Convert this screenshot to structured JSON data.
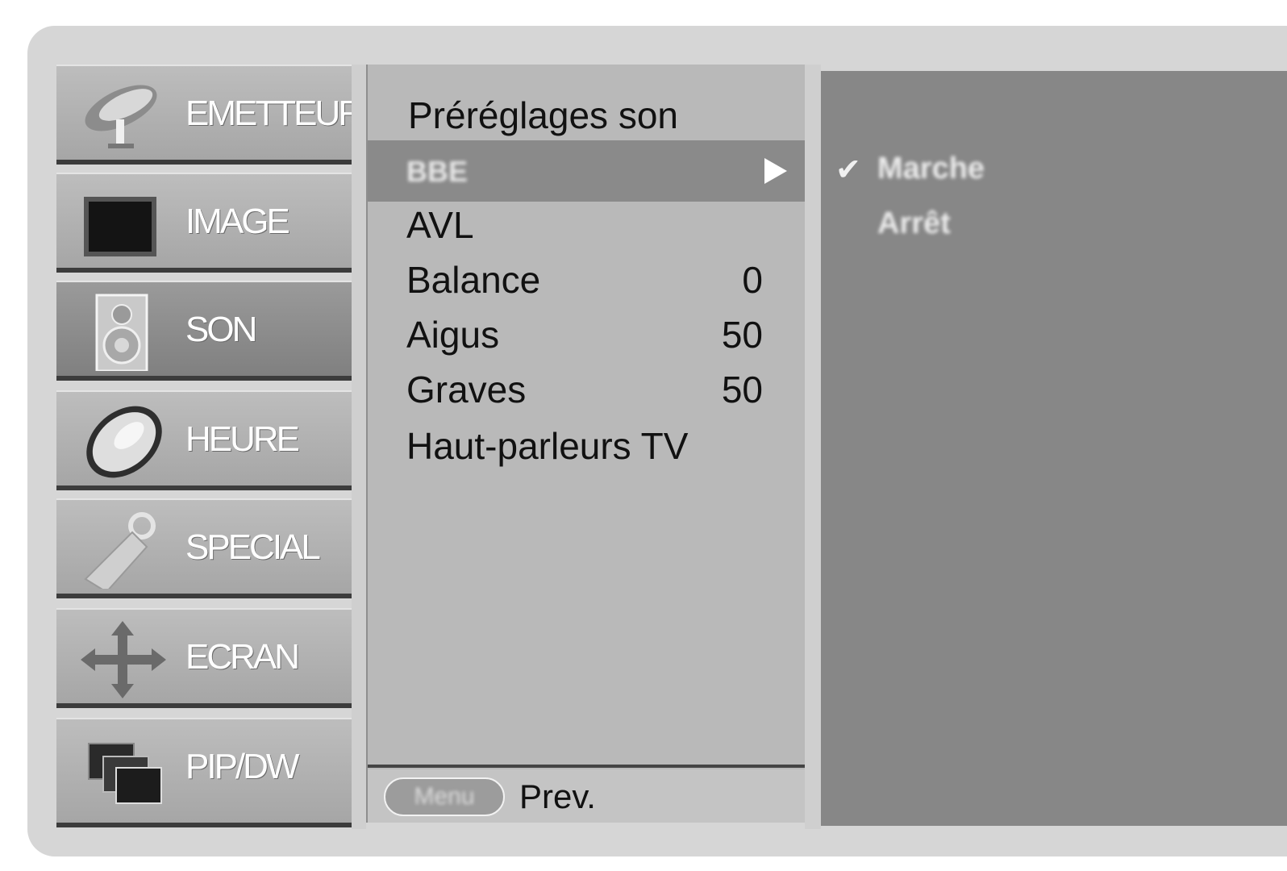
{
  "categories": [
    {
      "label": "EMETTEUR",
      "icon": "satellite-dish-icon",
      "active": false
    },
    {
      "label": "IMAGE",
      "icon": "tv-screen-icon",
      "active": false
    },
    {
      "label": "SON",
      "icon": "speaker-icon",
      "active": true
    },
    {
      "label": "HEURE",
      "icon": "clock-icon",
      "active": false
    },
    {
      "label": "SPECIAL",
      "icon": "key-tag-icon",
      "active": false
    },
    {
      "label": "ECRAN",
      "icon": "move-arrows-icon",
      "active": false
    },
    {
      "label": "PIP/DW",
      "icon": "pip-windows-icon",
      "active": false
    }
  ],
  "submenu": {
    "title": "Préréglages son",
    "highlighted_item": "BBE",
    "items": [
      {
        "label": "AVL",
        "value": ""
      },
      {
        "label": "Balance",
        "value": "0"
      },
      {
        "label": "Aigus",
        "value": "50"
      },
      {
        "label": "Graves",
        "value": "50"
      },
      {
        "label": "Haut-parleurs TV",
        "value": ""
      }
    ],
    "footer": {
      "button_label": "Menu",
      "action_label": "Prev."
    }
  },
  "options": {
    "items": [
      {
        "label": "Marche",
        "selected": true
      },
      {
        "label": "Arrêt",
        "selected": false
      }
    ]
  },
  "colors": {
    "panel": "#d6d6d6",
    "highlight": "#8a8a8a",
    "option_panel": "#878787"
  }
}
